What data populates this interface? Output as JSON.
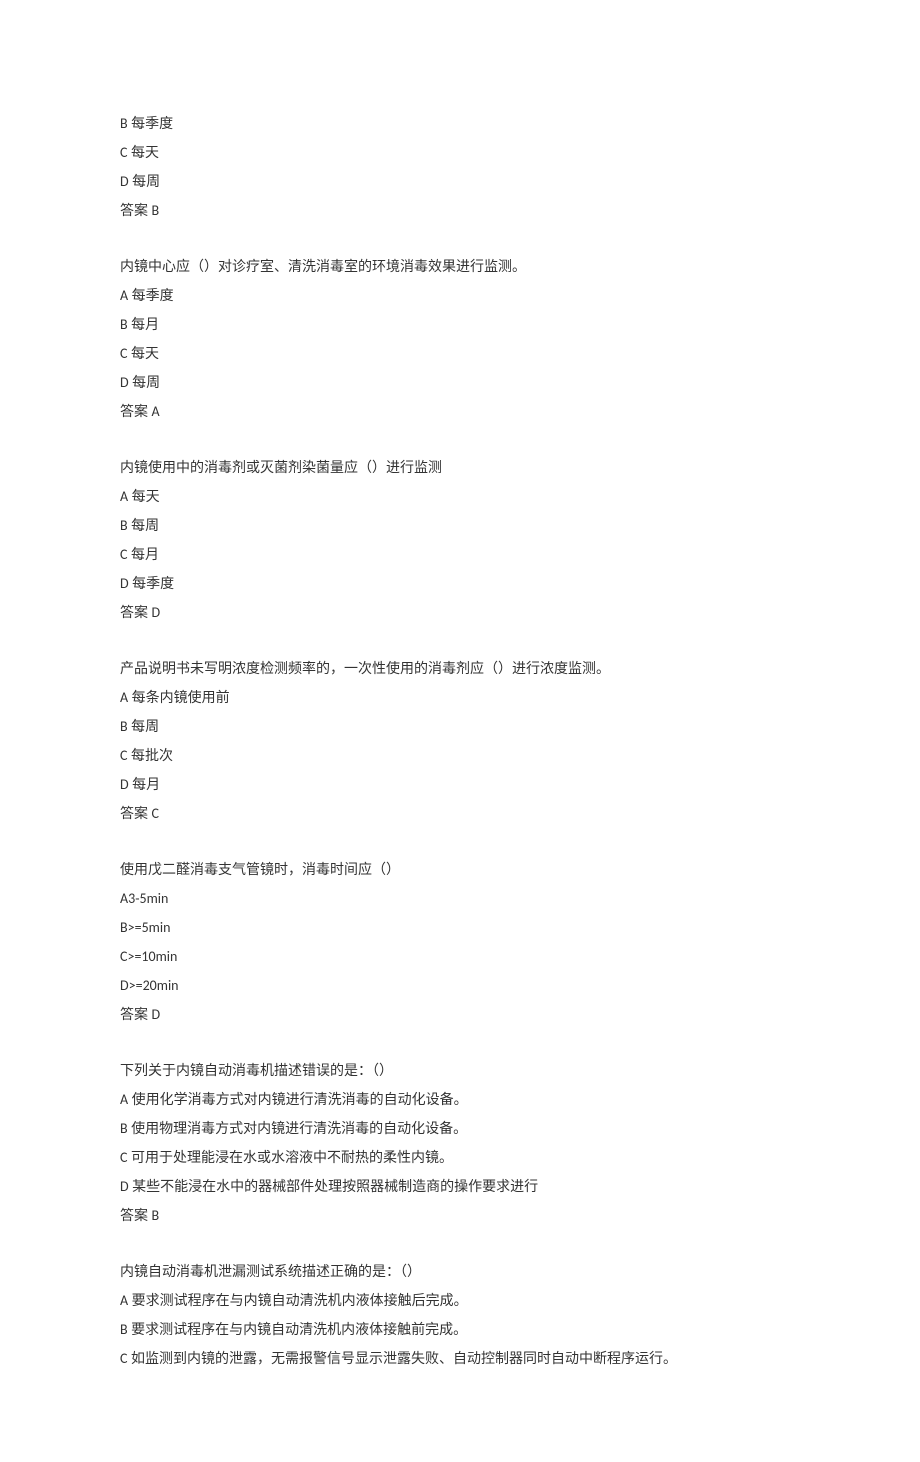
{
  "questions": [
    {
      "stem": "",
      "options": [
        {
          "label": "B",
          "text": "每季度"
        },
        {
          "label": "C",
          "text": "每天"
        },
        {
          "label": "D",
          "text": "每周"
        }
      ],
      "answer_label": "答案",
      "answer": "B"
    },
    {
      "stem": "内镜中心应（）对诊疗室、清洗消毒室的环境消毒效果进行监测。",
      "options": [
        {
          "label": "A",
          "text": "每季度"
        },
        {
          "label": "B",
          "text": "每月"
        },
        {
          "label": "C",
          "text": "每天"
        },
        {
          "label": "D",
          "text": "每周"
        }
      ],
      "answer_label": "答案",
      "answer": "A"
    },
    {
      "stem": "内镜使用中的消毒剂或灭菌剂染菌量应（）进行监测",
      "options": [
        {
          "label": "A",
          "text": "每天"
        },
        {
          "label": "B",
          "text": "每周"
        },
        {
          "label": "C",
          "text": "每月"
        },
        {
          "label": "D",
          "text": "每季度"
        }
      ],
      "answer_label": "答案",
      "answer": "D"
    },
    {
      "stem": "产品说明书未写明浓度检测频率的，一次性使用的消毒剂应（）进行浓度监测。",
      "options": [
        {
          "label": "A",
          "text": "每条内镜使用前"
        },
        {
          "label": "B",
          "text": "每周"
        },
        {
          "label": "C",
          "text": "每批次"
        },
        {
          "label": "D",
          "text": "每月"
        }
      ],
      "answer_label": "答案",
      "answer": "C"
    },
    {
      "stem": "使用戊二醛消毒支气管镜时，消毒时间应（）",
      "options": [
        {
          "label": "A",
          "text": "3-5min"
        },
        {
          "label": "B",
          "text": ">=5min"
        },
        {
          "label": "C",
          "text": ">=10min"
        },
        {
          "label": "D",
          "text": ">=20min"
        }
      ],
      "answer_label": "答案",
      "answer": "D"
    },
    {
      "stem": "下列关于内镜自动消毒机描述错误的是：（）",
      "options": [
        {
          "label": "A",
          "text": "使用化学消毒方式对内镜进行清洗消毒的自动化设备。"
        },
        {
          "label": "B",
          "text": "使用物理消毒方式对内镜进行清洗消毒的自动化设备。"
        },
        {
          "label": "C",
          "text": "可用于处理能浸在水或水溶液中不耐热的柔性内镜。"
        },
        {
          "label": "D",
          "text": "某些不能浸在水中的器械部件处理按照器械制造商的操作要求进行"
        }
      ],
      "answer_label": "答案",
      "answer": "B"
    },
    {
      "stem": "内镜自动消毒机泄漏测试系统描述正确的是：（）",
      "options": [
        {
          "label": "A",
          "text": "要求测试程序在与内镜自动清洗机内液体接触后完成。"
        },
        {
          "label": "B",
          "text": "要求测试程序在与内镜自动清洗机内液体接触前完成。"
        },
        {
          "label": "C",
          "text": "如监测到内镜的泄露，无需报警信号显示泄露失败、自动控制器同时自动中断程序运行。"
        }
      ],
      "answer_label": "",
      "answer": ""
    }
  ]
}
